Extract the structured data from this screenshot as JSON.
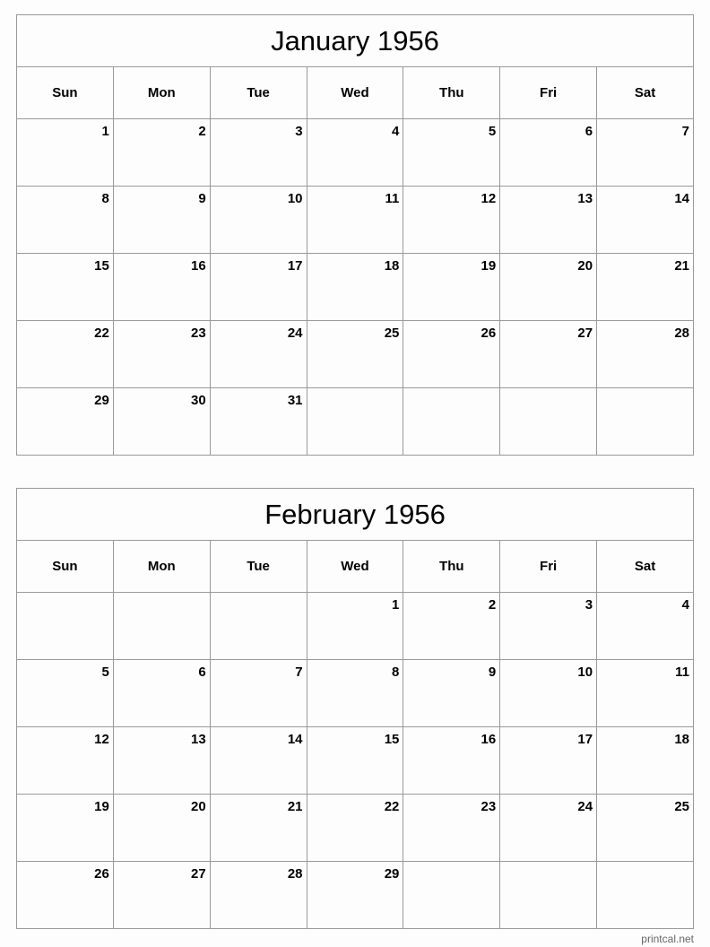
{
  "weekdays": [
    "Sun",
    "Mon",
    "Tue",
    "Wed",
    "Thu",
    "Fri",
    "Sat"
  ],
  "months": [
    {
      "title": "January 1956",
      "weeks": [
        [
          "1",
          "2",
          "3",
          "4",
          "5",
          "6",
          "7"
        ],
        [
          "8",
          "9",
          "10",
          "11",
          "12",
          "13",
          "14"
        ],
        [
          "15",
          "16",
          "17",
          "18",
          "19",
          "20",
          "21"
        ],
        [
          "22",
          "23",
          "24",
          "25",
          "26",
          "27",
          "28"
        ],
        [
          "29",
          "30",
          "31",
          "",
          "",
          "",
          ""
        ]
      ]
    },
    {
      "title": "February 1956",
      "weeks": [
        [
          "",
          "",
          "",
          "1",
          "2",
          "3",
          "4"
        ],
        [
          "5",
          "6",
          "7",
          "8",
          "9",
          "10",
          "11"
        ],
        [
          "12",
          "13",
          "14",
          "15",
          "16",
          "17",
          "18"
        ],
        [
          "19",
          "20",
          "21",
          "22",
          "23",
          "24",
          "25"
        ],
        [
          "26",
          "27",
          "28",
          "29",
          "",
          "",
          ""
        ]
      ]
    }
  ],
  "footer": "printcal.net"
}
